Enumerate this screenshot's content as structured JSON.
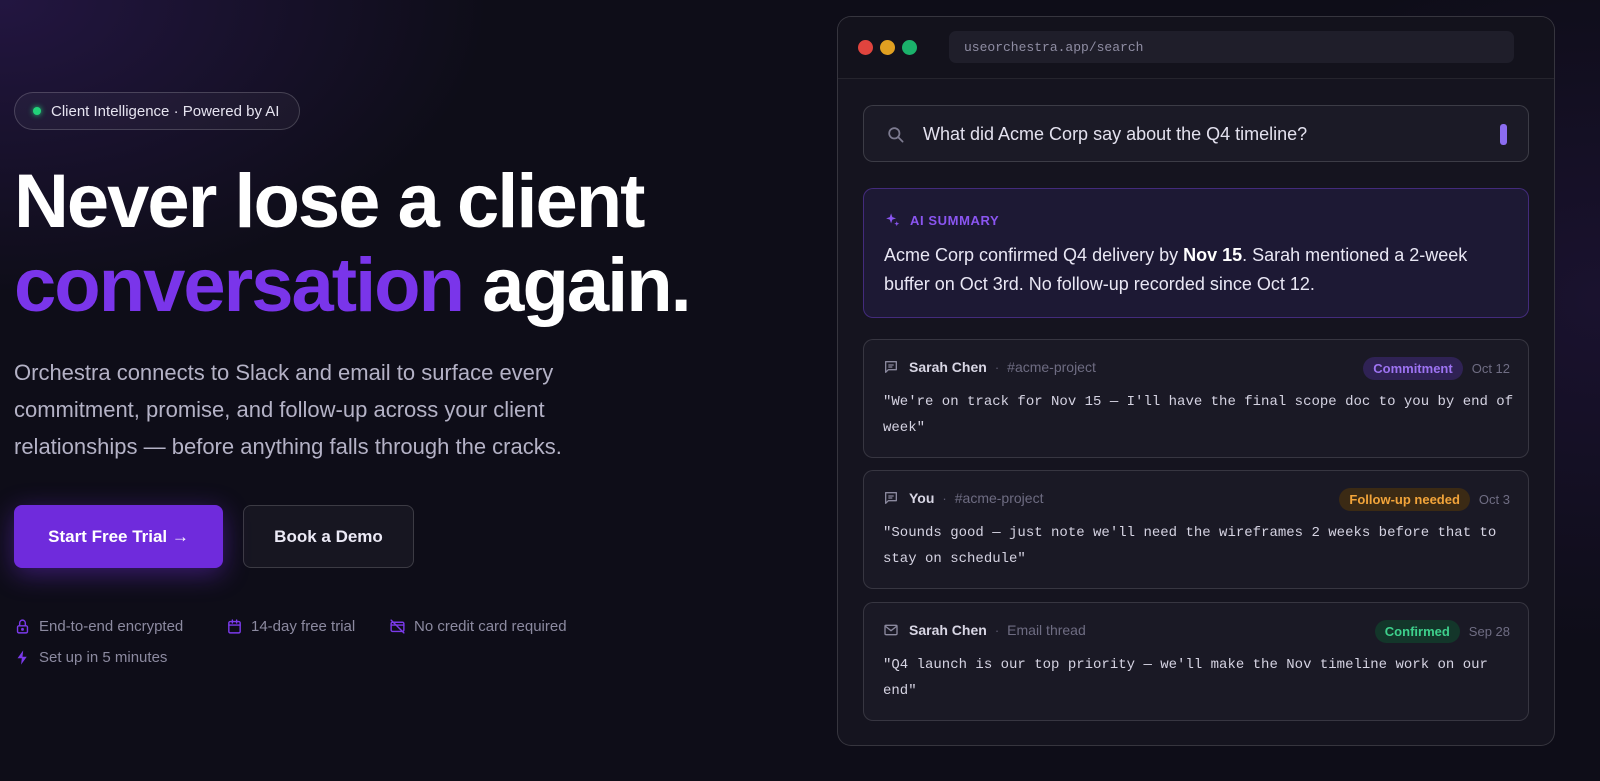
{
  "hero": {
    "badge": "Client Intelligence · Powered by AI",
    "headline_line1": "Never lose a client",
    "headline_accent": "conversation",
    "headline_end": "again.",
    "lead": "Orchestra connects to Slack and email to surface every commitment, promise, and follow-up across your client relationships — before anything falls through the cracks.",
    "primary_cta": "Start Free Trial →",
    "secondary_cta": "Book a Demo",
    "trust": [
      {
        "icon": "lock-icon",
        "label": "End-to-end encrypted"
      },
      {
        "icon": "calendar-icon",
        "label": "14-day free trial"
      },
      {
        "icon": "no-credit-card-icon",
        "label": "No credit card required"
      },
      {
        "icon": "bolt-icon",
        "label": "Set up in 5 minutes"
      }
    ]
  },
  "browser": {
    "url": "useorchestra.app/search",
    "traffic_lights": [
      "#e0443e",
      "#e0a021",
      "#1bb26b"
    ],
    "search_query": "What did Acme Corp say about the Q4 timeline?",
    "summary": {
      "label": "AI SUMMARY",
      "text_pre": "Acme Corp confirmed Q4 delivery by ",
      "text_bold": "Nov 15",
      "text_post": ". Sarah mentioned a 2-week buffer on Oct 3rd. No follow-up recorded since Oct 12."
    },
    "results": [
      {
        "icon": "message-icon",
        "author": "Sarah Chen",
        "sep": "·",
        "channel": "#acme-project",
        "badge": "Commitment",
        "date": "Oct 12",
        "quote": "\"We're on track for Nov 15 — I'll have the final scope doc to you by end of week\""
      },
      {
        "icon": "message-icon",
        "author": "You",
        "sep": "·",
        "channel": "#acme-project",
        "badge": "Follow-up needed",
        "date": "Oct 3",
        "quote": "\"Sounds good — just note we'll need the wireframes 2 weeks before that to stay on schedule\""
      },
      {
        "icon": "mail-icon",
        "author": "Sarah Chen",
        "sep": "·",
        "channel": "Email thread",
        "badge": "Confirmed",
        "date": "Sep 28",
        "quote": "\"Q4 launch is our top priority — we'll make the Nov timeline work on our end\""
      }
    ]
  },
  "colors": {
    "accent": "#7a35ea",
    "button": "#6f2bdc",
    "background": "#0e0d18"
  }
}
